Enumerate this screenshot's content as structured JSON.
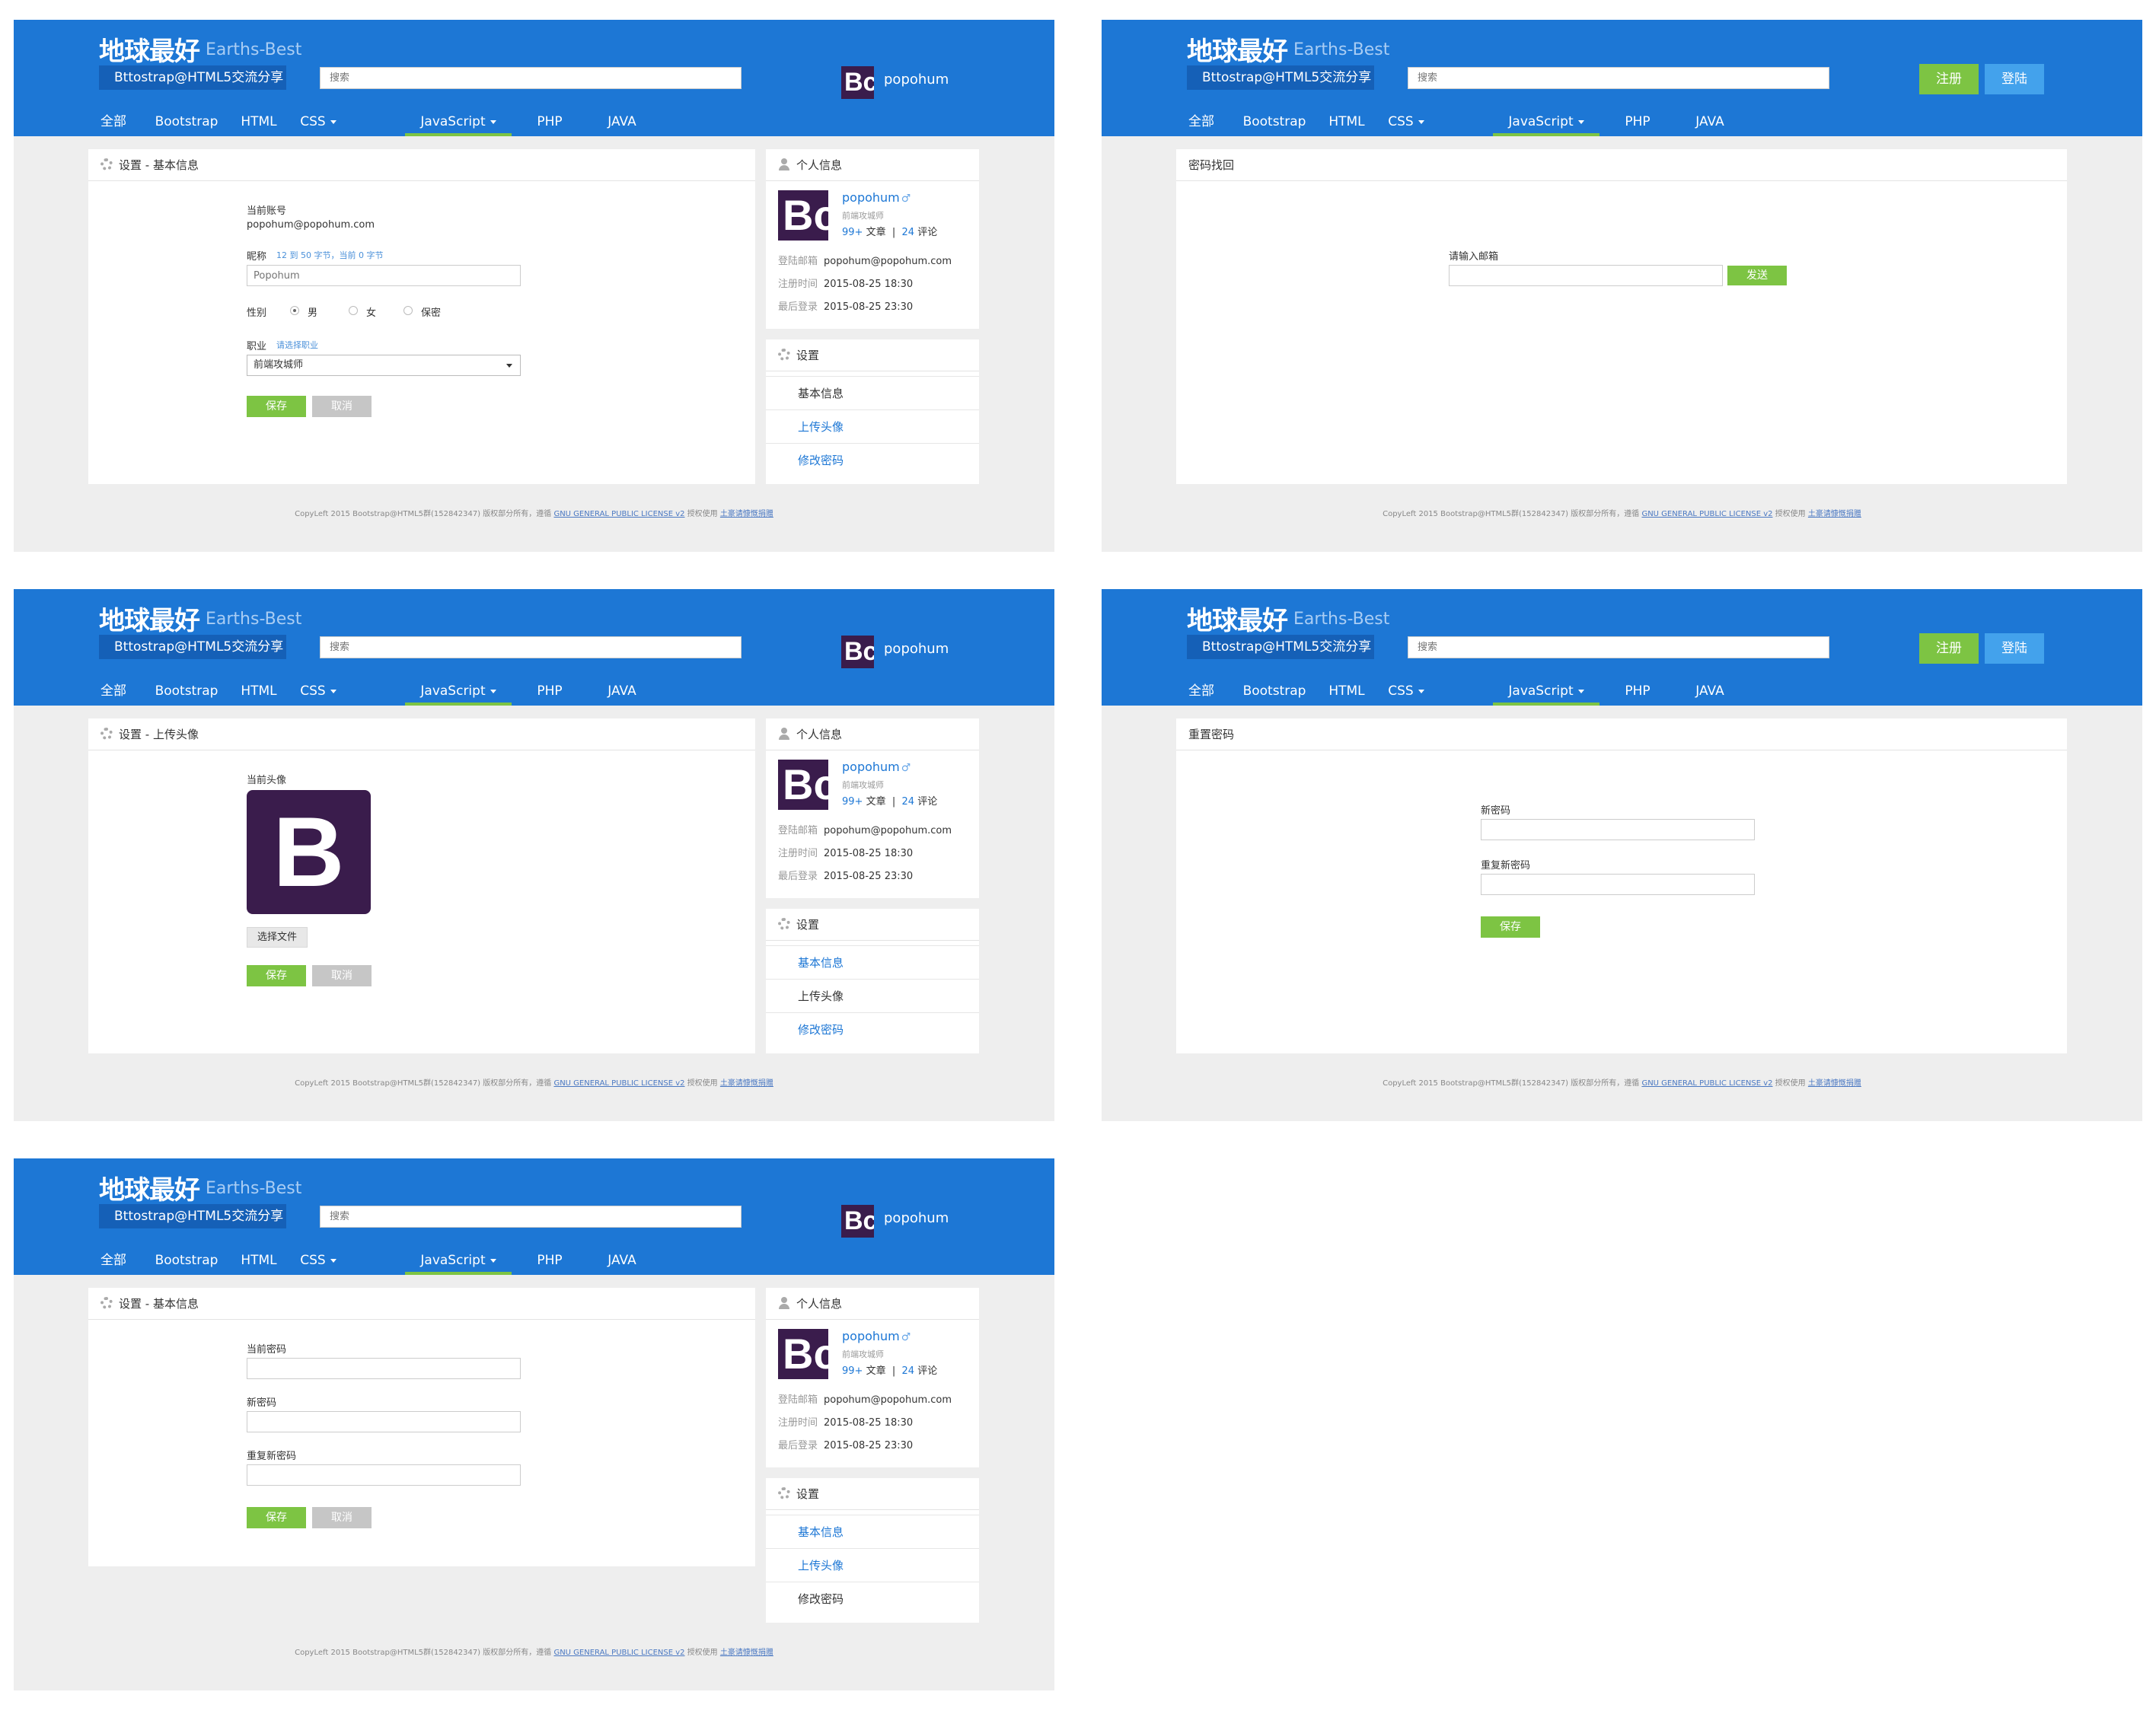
{
  "header": {
    "logo_zh": "地球最好",
    "logo_en": "Earths-Best",
    "subtitle": "Bttostrap@HTML5交流分享",
    "search_placeholder": "搜索",
    "user_badge": "Bc",
    "username": "popohum",
    "register_label": "注册",
    "login_label": "登陆",
    "nav": [
      "全部",
      "Bootstrap",
      "HTML",
      "CSS",
      "JavaScript",
      "PHP",
      "JAVA"
    ],
    "nav_active": "JavaScript"
  },
  "profile": {
    "title": "个人信息",
    "avatar_text": "Bc",
    "name": "popohum",
    "gender_symbol": "♂",
    "job": "前端攻城师",
    "articles_count": "99+",
    "articles_label": "文章",
    "separator": "|",
    "comments_count": "24",
    "comments_label": "评论",
    "email_label": "登陆邮箱",
    "email": "popohum@popohum.com",
    "reg_label": "注册时间",
    "reg_time": "2015-08-25 18:30",
    "last_label": "最后登录",
    "last_time": "2015-08-25 23:30"
  },
  "settings_menu": {
    "title": "设置",
    "items": [
      "基本信息",
      "上传头像",
      "修改密码"
    ]
  },
  "buttons": {
    "save": "保存",
    "cancel": "取消",
    "send": "发送",
    "choose_file": "选择文件"
  },
  "basic_info": {
    "title": "设置 - 基本信息",
    "account_label": "当前账号",
    "account_value": "popohum@popohum.com",
    "nickname_label": "昵称",
    "nickname_hint": "12 到 50 字节，当前 0 字节",
    "nickname_placeholder": "Popohum",
    "gender_label": "性别",
    "gender_options": [
      "男",
      "女",
      "保密"
    ],
    "gender_selected": "男",
    "job_label": "职业",
    "job_hint": "请选择职业",
    "job_value": "前端攻城师"
  },
  "find_password": {
    "title": "密码找回",
    "email_label": "请输入邮箱"
  },
  "upload_avatar": {
    "title": "设置 - 上传头像",
    "current_label": "当前头像",
    "avatar_letter": "B"
  },
  "reset_password": {
    "title": "重置密码",
    "new_label": "新密码",
    "repeat_label": "重复新密码"
  },
  "change_password": {
    "title": "设置 - 基本信息",
    "current_label": "当前密码",
    "new_label": "新密码",
    "repeat_label": "重复新密码"
  },
  "footer": {
    "text1": "CopyLeft 2015 Bootstrap@HTML5群(152842347) 版权部分所有，遵循",
    "license": "GNU GENERAL PUBLIC LICENSE v2",
    "text2": "授权使用",
    "link2": "土豪请慷慨捐赠"
  }
}
